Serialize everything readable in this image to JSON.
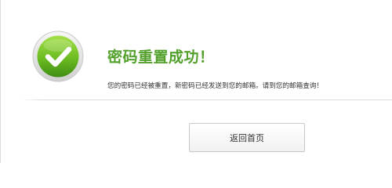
{
  "result": {
    "icon": "checkmark-circle-icon",
    "title": "密码重置成功！",
    "message": "您的密码已经被重置，新密码已经发送到您的邮箱。请到您的邮箱查询！"
  },
  "actions": {
    "home_label": "返回首页"
  },
  "colors": {
    "accent_green": "#53a12c",
    "icon_green": "#6cbc22"
  }
}
